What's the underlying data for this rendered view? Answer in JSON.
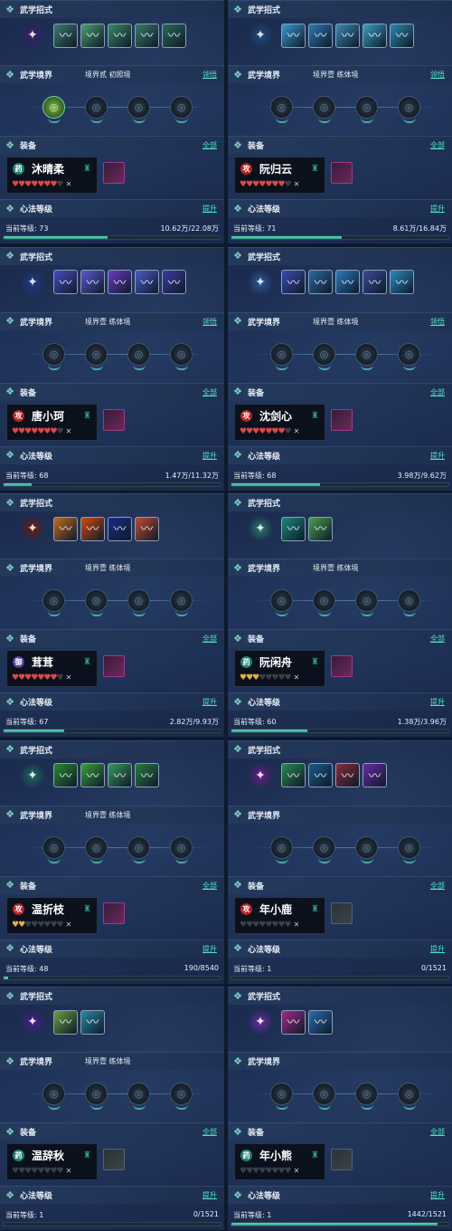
{
  "labels": {
    "skills_title": "武学招式",
    "realm_title": "武学境界",
    "equip_title": "装备",
    "all_link": "全部",
    "heart_title": "心法等级",
    "upgrade_link": "提升",
    "comprehend_link": "领悟",
    "level_prefix": "当前等级: "
  },
  "colors": {
    "accent": "#52e0c8",
    "bar_fill": "#3fb8a0",
    "heart_full": "#e0484a",
    "heart_empty": "#3a3f48"
  },
  "panels": [
    {
      "stage": "境界贰  初照境",
      "link": "领悟",
      "badge": "药",
      "badge_color": "teal",
      "name": "沐晴柔",
      "level": "73",
      "exp": "10.62万/22.08万",
      "progress": 0.48,
      "hearts_full": 7,
      "equip": true,
      "skills": [
        "#3a1c6a",
        "#3c7a6a",
        "#4aa070",
        "#3a8a66",
        "#3a7a66",
        "#2a6a5a"
      ],
      "nodes_on": 1
    },
    {
      "stage": "境界壹  练体境",
      "link": "领悟",
      "badge": "攻",
      "badge_color": "red",
      "name": "阮归云",
      "level": "71",
      "exp": "8.61万/16.84万",
      "progress": 0.51,
      "hearts_full": 7,
      "equip": true,
      "skills": [
        "#1c4a7a",
        "#3a9ad0",
        "#2a7ab0",
        "#3a8ab0",
        "#3aa0c0",
        "#2a8ab0"
      ],
      "nodes_on": 0
    },
    {
      "stage": "境界壹  练体境",
      "link": "领悟",
      "badge": "攻",
      "badge_color": "red",
      "name": "唐小珂",
      "level": "68",
      "exp": "1.47万/11.32万",
      "progress": 0.13,
      "hearts_full": 7,
      "equip": true,
      "skills": [
        "#1c3a8a",
        "#4a4ac0",
        "#5a5ad0",
        "#6a3ac0",
        "#4a5ac8",
        "#3a3aa0"
      ],
      "nodes_on": 0
    },
    {
      "stage": "境界壹  练体境",
      "link": "领悟",
      "badge": "攻",
      "badge_color": "red",
      "name": "沈剑心",
      "level": "68",
      "exp": "3.98万/9.62万",
      "progress": 0.41,
      "hearts_full": 7,
      "equip": true,
      "skills": [
        "#2a5a9a",
        "#3a4ab0",
        "#2a6aa0",
        "#2a7ac0",
        "#3a4a9a",
        "#2a8ac0"
      ],
      "nodes_on": 0
    },
    {
      "stage": "境界壹  练体境",
      "link": "",
      "badge": "御",
      "badge_color": "purple",
      "name": "茸茸",
      "level": "67",
      "exp": "2.82万/9.93万",
      "progress": 0.28,
      "hearts_full": 7,
      "equip": true,
      "skills": [
        "#6a1a0a",
        "#c06a20",
        "#d04a10",
        "#1a2a8a",
        "#c04a30"
      ],
      "nodes_on": 0
    },
    {
      "stage": "境界壹  练体境",
      "link": "",
      "badge": "药",
      "badge_color": "teal",
      "name": "阮闲舟",
      "level": "60",
      "exp": "1.38万/3.96万",
      "progress": 0.35,
      "hearts_full": 3,
      "equip": true,
      "skills": [
        "#2a7a6a",
        "#1a8a7a",
        "#4aa050"
      ],
      "nodes_on": 0
    },
    {
      "stage": "境界壹  练体境",
      "link": "",
      "badge": "攻",
      "badge_color": "red",
      "name": "温折枝",
      "level": "48",
      "exp": "190/8540",
      "progress": 0.02,
      "hearts_full": 2,
      "equip": true,
      "skills": [
        "#1a6a5a",
        "#2a8a30",
        "#3aa03a",
        "#3a9a5a",
        "#2a7a40"
      ],
      "nodes_on": 0
    },
    {
      "stage": "",
      "link": "",
      "badge": "攻",
      "badge_color": "red",
      "name": "年小鹿",
      "level": "1",
      "exp": "0/1521",
      "progress": 0.0,
      "hearts_full": 0,
      "equip": false,
      "skills": [
        "#6a1a8a",
        "#2a8a50",
        "#1a5a8a",
        "#8a2a3a",
        "#6a2aa0"
      ],
      "nodes_on": 0
    },
    {
      "stage": "境界壹  练体境",
      "link": "",
      "badge": "药",
      "badge_color": "teal",
      "name": "温辞秋",
      "level": "1",
      "exp": "0/1521",
      "progress": 0.0,
      "hearts_full": 0,
      "equip": false,
      "skills": [
        "#4a1a8a",
        "#6aa040",
        "#2a8aa0"
      ],
      "nodes_on": 0
    },
    {
      "stage": "",
      "link": "",
      "badge": "药",
      "badge_color": "teal",
      "name": "年小熊",
      "level": "1",
      "exp": "1442/1521",
      "progress": 0.95,
      "hearts_full": 0,
      "equip": false,
      "skills": [
        "#6a2aa0",
        "#a02a8a",
        "#2a6ab0"
      ],
      "nodes_on": 0
    }
  ]
}
